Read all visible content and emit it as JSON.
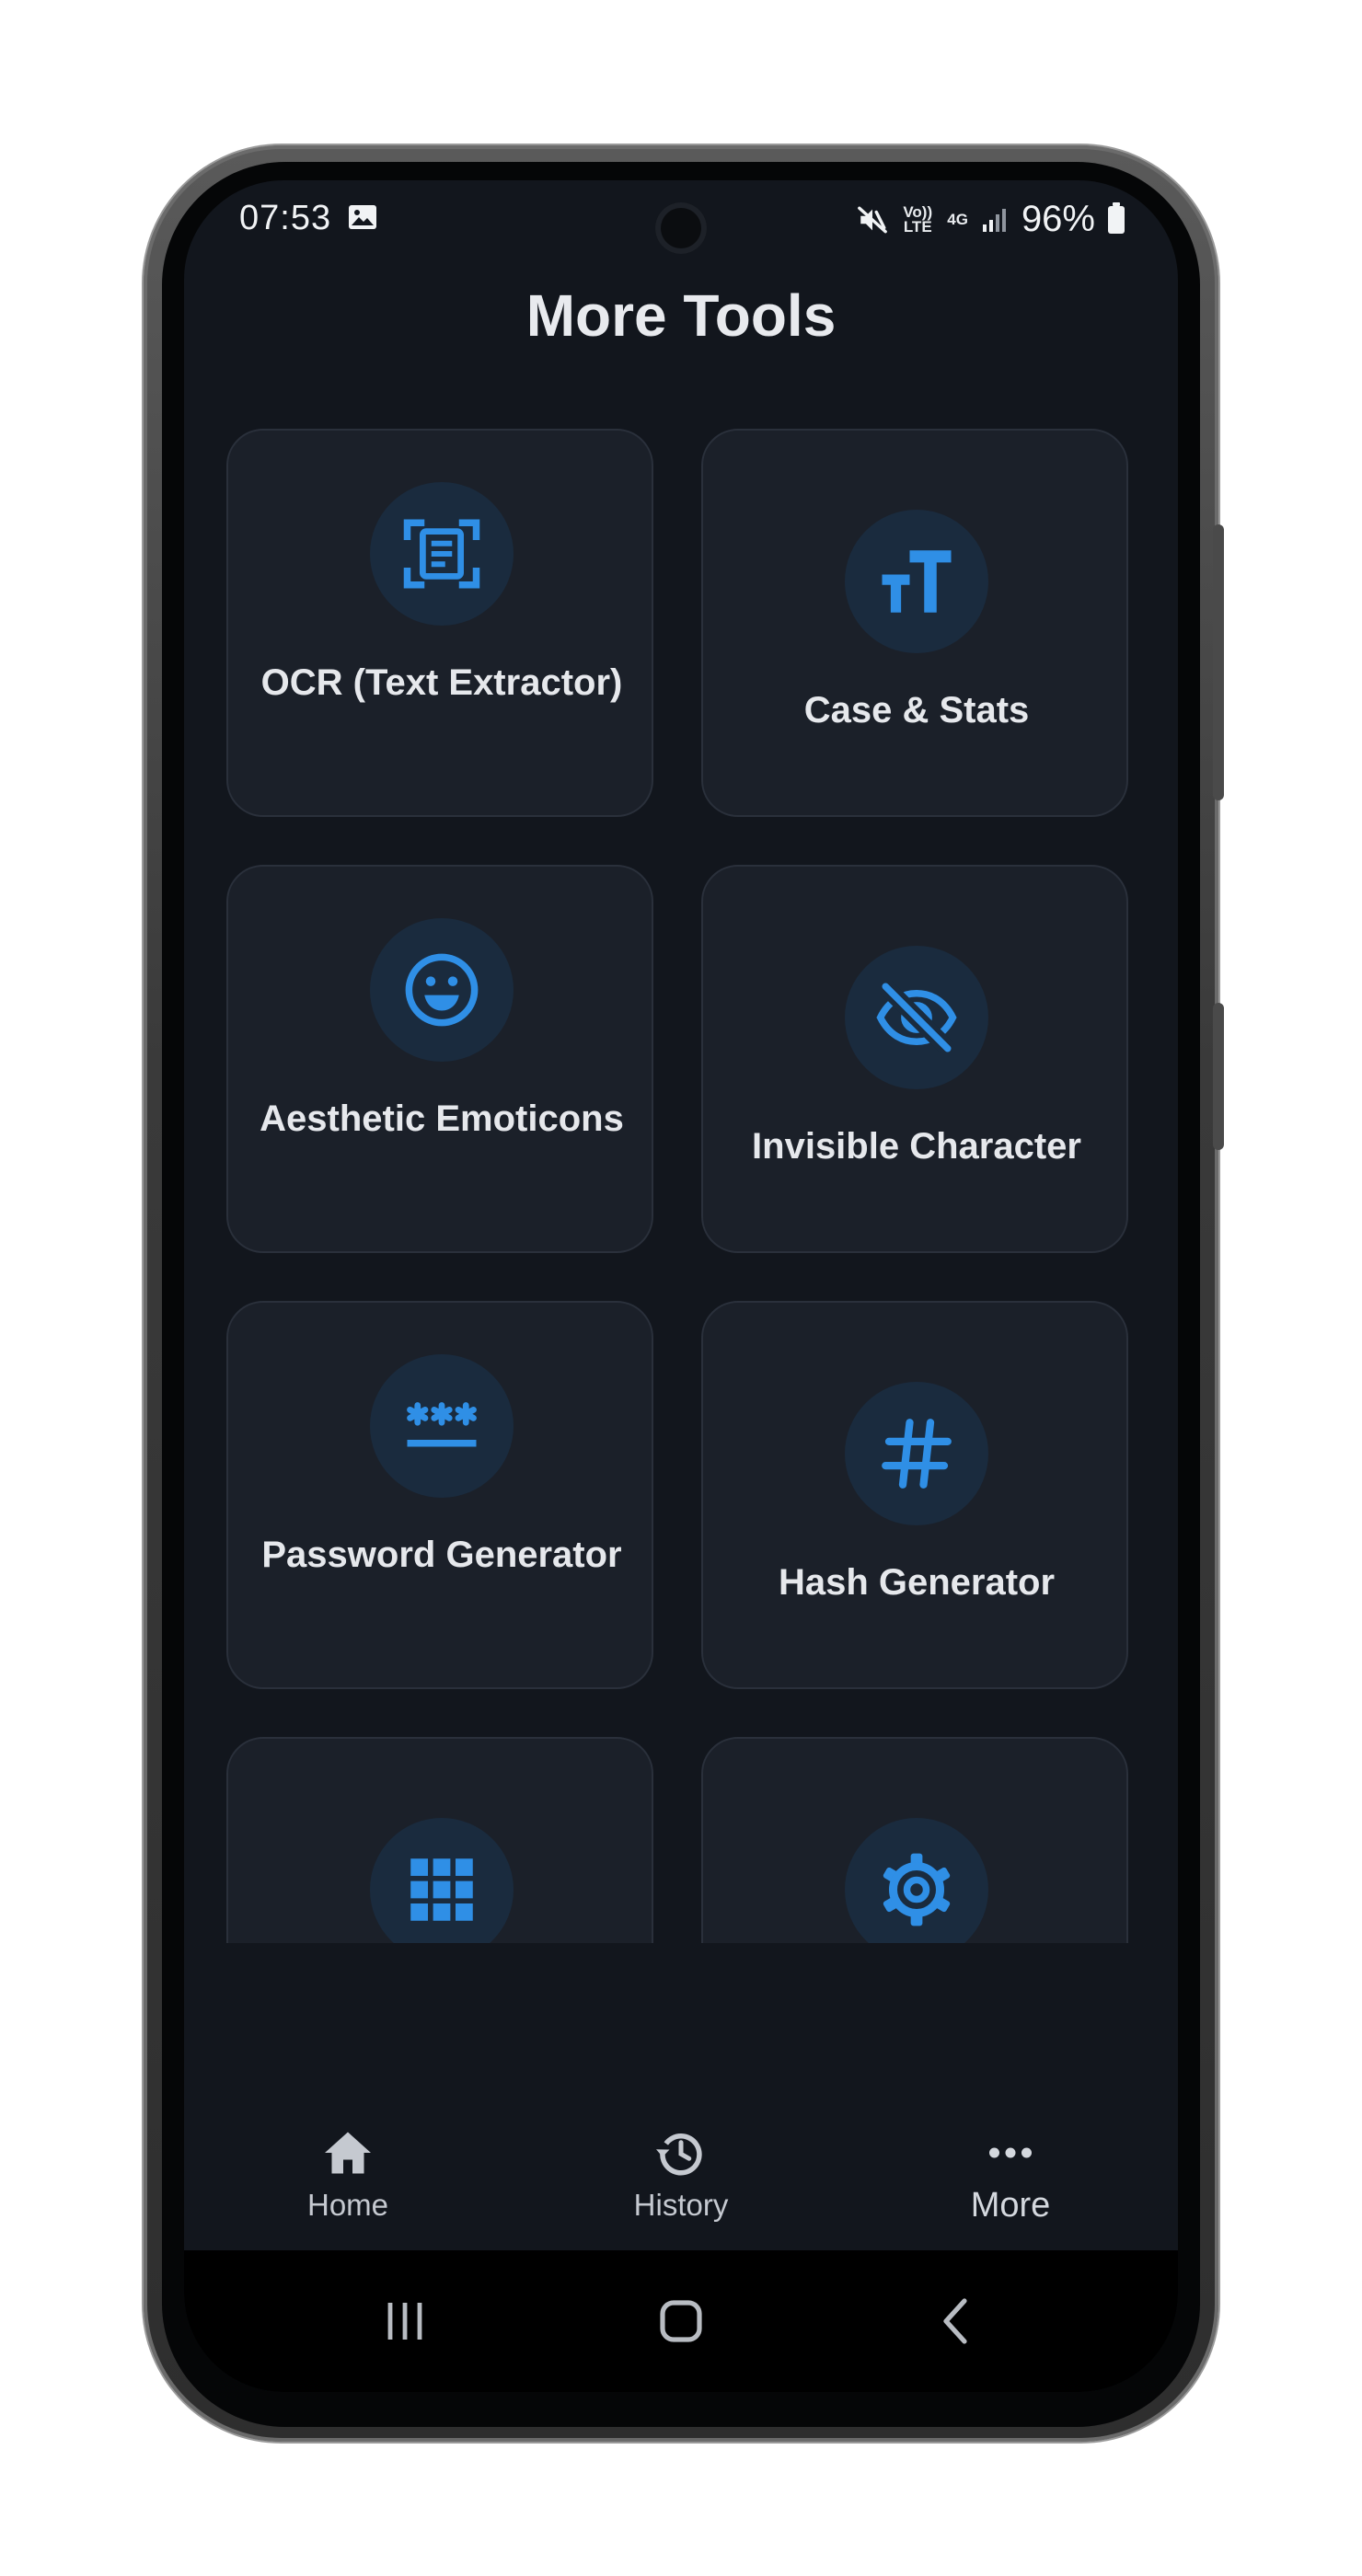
{
  "status_bar": {
    "time": "07:53",
    "volte_label": "Vo)) LTE",
    "network_label": "4G",
    "battery": "96%",
    "icons": [
      "image-icon",
      "mute-icon",
      "volte-icon",
      "4g-icon",
      "signal-icon",
      "battery-icon"
    ]
  },
  "page": {
    "title": "More Tools"
  },
  "tools": [
    {
      "label": "OCR (Text Extractor)",
      "icon": "document-scan-icon"
    },
    {
      "label": "Case & Stats",
      "icon": "text-size-icon"
    },
    {
      "label": "Aesthetic Emoticons",
      "icon": "smiley-icon"
    },
    {
      "label": "Invisible Character",
      "icon": "eye-off-icon"
    },
    {
      "label": "Password Generator",
      "icon": "password-icon"
    },
    {
      "label": "Hash Generator",
      "icon": "hash-icon"
    },
    {
      "label": "",
      "icon": "apps-grid-icon"
    },
    {
      "label": "",
      "icon": "gear-icon"
    }
  ],
  "bottom_nav": {
    "items": [
      {
        "label": "Home",
        "icon": "home-icon"
      },
      {
        "label": "History",
        "icon": "history-icon"
      },
      {
        "label": "More",
        "icon": "more-horizontal-icon"
      }
    ],
    "selected": "More"
  },
  "colors": {
    "background": "#12161d",
    "card": "#1b2029",
    "card_border": "#2a303b",
    "accent": "#2f8fe6",
    "icon_circle": "#1a2b3e",
    "text": "#e6e8ec"
  }
}
